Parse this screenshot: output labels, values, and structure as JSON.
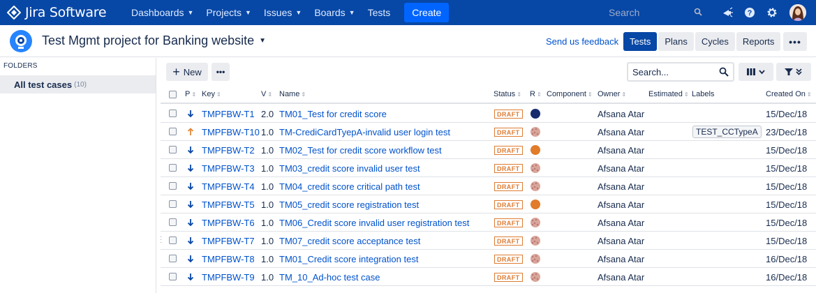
{
  "topnav": {
    "brand": "Jira Software",
    "items": [
      {
        "label": "Dashboards",
        "dropdown": true
      },
      {
        "label": "Projects",
        "dropdown": true
      },
      {
        "label": "Issues",
        "dropdown": true
      },
      {
        "label": "Boards",
        "dropdown": true
      },
      {
        "label": "Tests",
        "dropdown": false
      }
    ],
    "create_label": "Create",
    "search_placeholder": "Search"
  },
  "project": {
    "title": "Test Mgmt project for Banking website",
    "feedback_link": "Send us feedback",
    "tabs": [
      {
        "label": "Tests",
        "active": true
      },
      {
        "label": "Plans",
        "active": false
      },
      {
        "label": "Cycles",
        "active": false
      },
      {
        "label": "Reports",
        "active": false
      }
    ]
  },
  "sidebar": {
    "folders_label": "FOLDERS",
    "items": [
      {
        "label": "All test cases",
        "count": "(10)"
      }
    ]
  },
  "toolbar": {
    "new_label": "New",
    "search_placeholder": "Search..."
  },
  "table": {
    "headers": {
      "priority": "P",
      "key": "Key",
      "version": "V",
      "name": "Name",
      "status": "Status",
      "result": "R",
      "component": "Component",
      "owner": "Owner",
      "estimated": "Estimated",
      "labels": "Labels",
      "created": "Created On"
    },
    "rows": [
      {
        "priority": "low",
        "key": "TMPFBW-T1",
        "version": "2.0",
        "name": "TM01_Test for credit score",
        "status": "DRAFT",
        "result": "navy",
        "owner": "Afsana Atar",
        "label": "",
        "created": "15/Dec/18"
      },
      {
        "priority": "high",
        "key": "TMPFBW-T10",
        "version": "1.0",
        "name": "TM-CrediCardTyepA-invalid user login test",
        "status": "DRAFT",
        "result": "default",
        "owner": "Afsana Atar",
        "label": "TEST_CCTypeA",
        "created": "23/Dec/18"
      },
      {
        "priority": "low",
        "key": "TMPFBW-T2",
        "version": "1.0",
        "name": "TM02_Test for credit score workflow test",
        "status": "DRAFT",
        "result": "orange",
        "owner": "Afsana Atar",
        "label": "",
        "created": "15/Dec/18"
      },
      {
        "priority": "low",
        "key": "TMPFBW-T3",
        "version": "1.0",
        "name": "TM03_credit score invalid user test",
        "status": "DRAFT",
        "result": "default",
        "owner": "Afsana Atar",
        "label": "",
        "created": "15/Dec/18"
      },
      {
        "priority": "low",
        "key": "TMPFBW-T4",
        "version": "1.0",
        "name": "TM04_credit score critical path test",
        "status": "DRAFT",
        "result": "default",
        "owner": "Afsana Atar",
        "label": "",
        "created": "15/Dec/18"
      },
      {
        "priority": "low",
        "key": "TMPFBW-T5",
        "version": "1.0",
        "name": "TM05_credit score registration test",
        "status": "DRAFT",
        "result": "orange",
        "owner": "Afsana Atar",
        "label": "",
        "created": "15/Dec/18"
      },
      {
        "priority": "low",
        "key": "TMPFBW-T6",
        "version": "1.0",
        "name": "TM06_Credit score invalid user registration test",
        "status": "DRAFT",
        "result": "default",
        "owner": "Afsana Atar",
        "label": "",
        "created": "15/Dec/18"
      },
      {
        "priority": "low",
        "key": "TMPFBW-T7",
        "version": "1.0",
        "name": "TM07_credit score acceptance test",
        "status": "DRAFT",
        "result": "default",
        "owner": "Afsana Atar",
        "label": "",
        "created": "15/Dec/18"
      },
      {
        "priority": "low",
        "key": "TMPFBW-T8",
        "version": "1.0",
        "name": "TM01_Credit score integration test",
        "status": "DRAFT",
        "result": "default",
        "owner": "Afsana Atar",
        "label": "",
        "created": "16/Dec/18"
      },
      {
        "priority": "low",
        "key": "TMPFBW-T9",
        "version": "1.0",
        "name": "TM_10_Ad-hoc test case",
        "status": "DRAFT",
        "result": "default",
        "owner": "Afsana Atar",
        "label": "",
        "created": "16/Dec/18"
      }
    ]
  },
  "colors": {
    "nav_bg": "#0747a6",
    "link": "#0052cc",
    "draft": "#de7c33",
    "priority_low": "#0747a6",
    "priority_high": "#e0873a"
  }
}
